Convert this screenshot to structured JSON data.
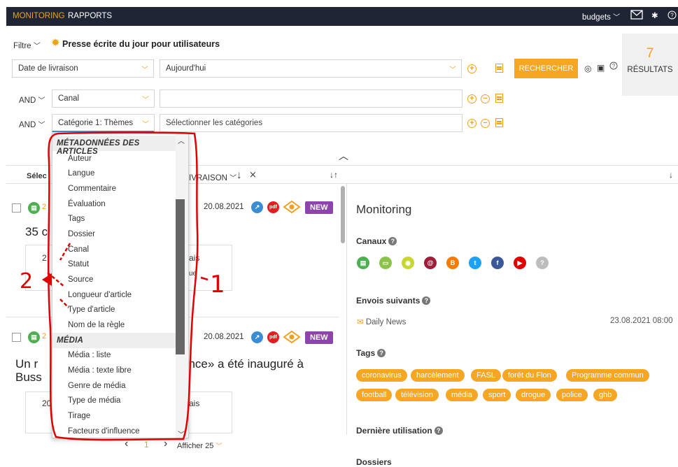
{
  "topbar": {
    "nav": [
      "MONITORING",
      "RAPPORTS"
    ],
    "budgets": "budgets",
    "budgets_chevron": "chevron-down-icon"
  },
  "filter": {
    "label": "Filtre",
    "title": "Presse écrite du jour pour utilisateurs"
  },
  "row1": {
    "field": "Date de livraison",
    "value": "Aujourd'hui",
    "search_button": "RECHERCHER"
  },
  "results": {
    "count": "7",
    "label": "RÉSULTATS"
  },
  "row2": {
    "logic": "AND",
    "field": "Canal",
    "value": ""
  },
  "row3": {
    "logic": "AND",
    "field": "Catégorie 1: Thèmes",
    "value": "Sélectionner les catégories"
  },
  "list_header": {
    "select": "Sélec",
    "sort": "IVRAISON"
  },
  "articles": [
    {
      "date": "20.08.2021",
      "title": "35 c",
      "badge": "NEW",
      "pdf": "pdf",
      "card_snippet": "2",
      "card_right_1": "ais",
      "card_right_2": "ue"
    },
    {
      "date": "20.08.2021",
      "title_left": "Un r",
      "title_left2": "Buss",
      "title_right": "ence» a été inauguré à",
      "badge": "NEW",
      "pdf": "pdf",
      "card_snippet": "20",
      "card_right_1": "ais"
    }
  ],
  "dropdown": {
    "sections": [
      {
        "header": "MÉTADONNÉES DES ARTICLES",
        "items": [
          "Auteur",
          "Langue",
          "Commentaire",
          "Évaluation",
          "Tags",
          "Dossier",
          "Canal",
          "Statut",
          "Source",
          "Longueur d'article",
          "Type d'article",
          "Nom de la règle"
        ]
      },
      {
        "header": "MÉDIA",
        "items": [
          "Média : liste",
          "Média : texte libre",
          "Genre de média",
          "Type de média",
          "Tirage",
          "Facteurs d'influence"
        ]
      }
    ]
  },
  "pagination": {
    "prev": "‹",
    "page": "1",
    "next": "›",
    "show": "Afficher 25"
  },
  "right_panel": {
    "title": "Monitoring",
    "channels_label": "Canaux",
    "next_sends_label": "Envois suivants",
    "send_name": "Daily News",
    "send_time": "23.08.2021 08:00",
    "tags_label": "Tags",
    "tags_row1": [
      "coronavirus",
      "harcèlement",
      "FASL",
      "forêt du Flon",
      "Programme commun"
    ],
    "tags_row2": [
      "football",
      "télévision",
      "média",
      "sport",
      "drogue",
      "police",
      "ghb"
    ],
    "last_use_label": "Dernière utilisation",
    "folders_label": "Dossiers"
  },
  "annotations": {
    "label1": "1",
    "label2": "2"
  },
  "colors": {
    "accent": "#f5a623",
    "dark": "#1f2535",
    "new_badge": "#8e44ad",
    "annotation": "#e00000"
  }
}
